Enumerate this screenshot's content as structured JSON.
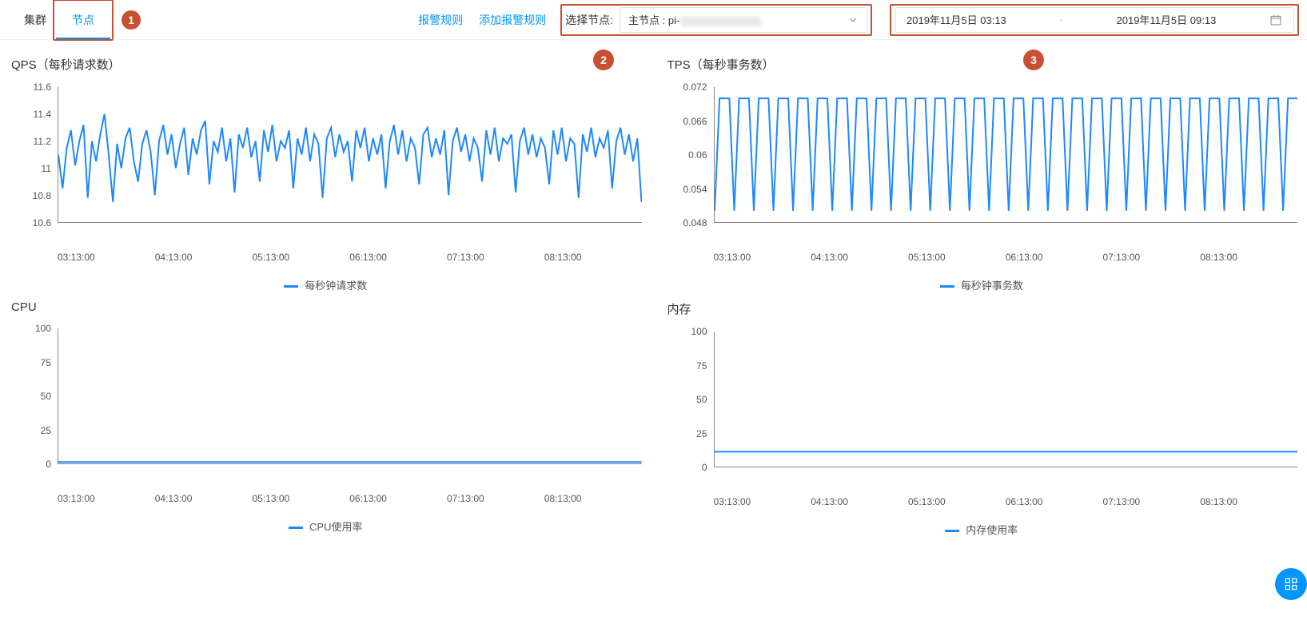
{
  "tabs": {
    "cluster": "集群",
    "node": "节点"
  },
  "links": {
    "alarm_rules": "报警规则",
    "add_alarm_rule": "添加报警规则"
  },
  "node_select": {
    "label": "选择节点:",
    "value_prefix": "主节点 : pi-"
  },
  "date": {
    "from": "2019年11月5日 03:13",
    "to": "2019年11月5日 09:13",
    "sep": "-"
  },
  "annotations": {
    "one": "1",
    "two": "2",
    "three": "3"
  },
  "chart_data": [
    {
      "id": "qps",
      "type": "line",
      "title": "QPS（每秒请求数）",
      "legend": "每秒钟请求数",
      "x_ticks": [
        "03:13:00",
        "04:13:00",
        "05:13:00",
        "06:13:00",
        "07:13:00",
        "08:13:00"
      ],
      "y_ticks": [
        10.6,
        10.8,
        11,
        11.2,
        11.4,
        11.6
      ],
      "ylim": [
        10.6,
        11.6
      ],
      "values": [
        11.1,
        10.85,
        11.15,
        11.28,
        11.02,
        11.2,
        11.32,
        10.78,
        11.2,
        11.05,
        11.25,
        11.4,
        11.1,
        10.75,
        11.18,
        11.0,
        11.22,
        11.3,
        11.05,
        10.9,
        11.18,
        11.28,
        11.12,
        10.8,
        11.2,
        11.32,
        11.1,
        11.25,
        11.0,
        11.18,
        11.3,
        10.95,
        11.22,
        11.1,
        11.28,
        11.35,
        10.88,
        11.2,
        11.12,
        11.3,
        11.05,
        11.22,
        10.82,
        11.25,
        11.15,
        11.3,
        11.08,
        11.2,
        10.9,
        11.28,
        11.12,
        11.32,
        11.05,
        11.2,
        11.15,
        11.28,
        10.85,
        11.22,
        11.1,
        11.3,
        11.05,
        11.25,
        11.18,
        10.78,
        11.22,
        11.3,
        11.08,
        11.25,
        11.12,
        11.2,
        10.9,
        11.28,
        11.15,
        11.3,
        11.05,
        11.22,
        11.1,
        11.25,
        10.85,
        11.2,
        11.32,
        11.1,
        11.28,
        11.05,
        11.22,
        11.15,
        10.88,
        11.25,
        11.3,
        11.08,
        11.22,
        11.1,
        11.28,
        10.8,
        11.2,
        11.3,
        11.12,
        11.25,
        11.05,
        11.22,
        11.15,
        10.9,
        11.28,
        11.1,
        11.3,
        11.05,
        11.22,
        11.18,
        11.25,
        10.82,
        11.2,
        11.3,
        11.1,
        11.25,
        11.08,
        11.22,
        11.15,
        10.88,
        11.28,
        11.1,
        11.3,
        11.05,
        11.22,
        11.18,
        10.78,
        11.25,
        11.12,
        11.3,
        11.08,
        11.22,
        11.15,
        11.28,
        10.85,
        11.2,
        11.3,
        11.1,
        11.25,
        11.05,
        11.22,
        10.75
      ]
    },
    {
      "id": "tps",
      "type": "line",
      "title": "TPS（每秒事务数）",
      "legend": "每秒钟事务数",
      "x_ticks": [
        "03:13:00",
        "04:13:00",
        "05:13:00",
        "06:13:00",
        "07:13:00",
        "08:13:00"
      ],
      "y_ticks": [
        0.048,
        0.054,
        0.06,
        0.066,
        0.072
      ],
      "ylim": [
        0.048,
        0.072
      ],
      "values": [
        0.05,
        0.07,
        0.07,
        0.07,
        0.05,
        0.07,
        0.07,
        0.07,
        0.05,
        0.07,
        0.07,
        0.07,
        0.05,
        0.07,
        0.07,
        0.07,
        0.05,
        0.07,
        0.07,
        0.07,
        0.05,
        0.07,
        0.07,
        0.07,
        0.05,
        0.07,
        0.07,
        0.07,
        0.05,
        0.07,
        0.07,
        0.07,
        0.05,
        0.07,
        0.07,
        0.07,
        0.05,
        0.07,
        0.07,
        0.07,
        0.05,
        0.07,
        0.07,
        0.07,
        0.05,
        0.07,
        0.07,
        0.07,
        0.05,
        0.07,
        0.07,
        0.07,
        0.05,
        0.07,
        0.07,
        0.07,
        0.05,
        0.07,
        0.07,
        0.07,
        0.05,
        0.07,
        0.07,
        0.07,
        0.05,
        0.07,
        0.07,
        0.07,
        0.05,
        0.07,
        0.07,
        0.07,
        0.05,
        0.07,
        0.07,
        0.07,
        0.05,
        0.07,
        0.07,
        0.07,
        0.05,
        0.07,
        0.07,
        0.07,
        0.05,
        0.07,
        0.07,
        0.07,
        0.05,
        0.07,
        0.07,
        0.07,
        0.05,
        0.07,
        0.07,
        0.07,
        0.05,
        0.07,
        0.07,
        0.07,
        0.05,
        0.07,
        0.07,
        0.07,
        0.05,
        0.07,
        0.07,
        0.07,
        0.05,
        0.07,
        0.07,
        0.07,
        0.05,
        0.07,
        0.07,
        0.07,
        0.05,
        0.07,
        0.07,
        0.07
      ]
    },
    {
      "id": "cpu",
      "type": "line",
      "title": "CPU",
      "legend": "CPU使用率",
      "x_ticks": [
        "03:13:00",
        "04:13:00",
        "05:13:00",
        "06:13:00",
        "07:13:00",
        "08:13:00"
      ],
      "y_ticks": [
        0,
        25,
        50,
        75,
        100
      ],
      "ylim": [
        0,
        100
      ],
      "values": [
        1,
        1,
        1,
        1,
        1,
        1,
        1,
        1,
        1,
        1,
        1,
        1,
        1,
        1,
        1,
        1,
        1,
        1,
        1,
        1,
        1,
        1,
        1,
        1,
        1,
        1,
        1,
        1,
        1,
        1,
        1,
        1,
        1,
        1,
        1,
        1,
        1,
        1,
        1,
        1,
        1,
        1,
        1,
        1,
        1,
        1,
        1,
        1,
        1,
        1
      ]
    },
    {
      "id": "mem",
      "type": "line",
      "title": "内存",
      "legend": "内存使用率",
      "x_ticks": [
        "03:13:00",
        "04:13:00",
        "05:13:00",
        "06:13:00",
        "07:13:00",
        "08:13:00"
      ],
      "y_ticks": [
        0,
        25,
        50,
        75,
        100
      ],
      "ylim": [
        0,
        100
      ],
      "values": [
        11,
        11,
        11,
        11,
        11,
        11,
        11,
        11,
        11,
        11,
        11,
        11,
        11,
        11,
        11,
        11,
        11,
        11,
        11,
        11,
        11,
        11,
        11,
        11,
        11,
        11,
        11,
        11,
        11,
        11,
        11,
        11,
        11,
        11,
        11,
        11,
        11,
        11,
        11,
        11,
        11,
        11,
        11,
        11,
        11,
        11,
        11,
        11,
        11,
        11
      ]
    }
  ]
}
